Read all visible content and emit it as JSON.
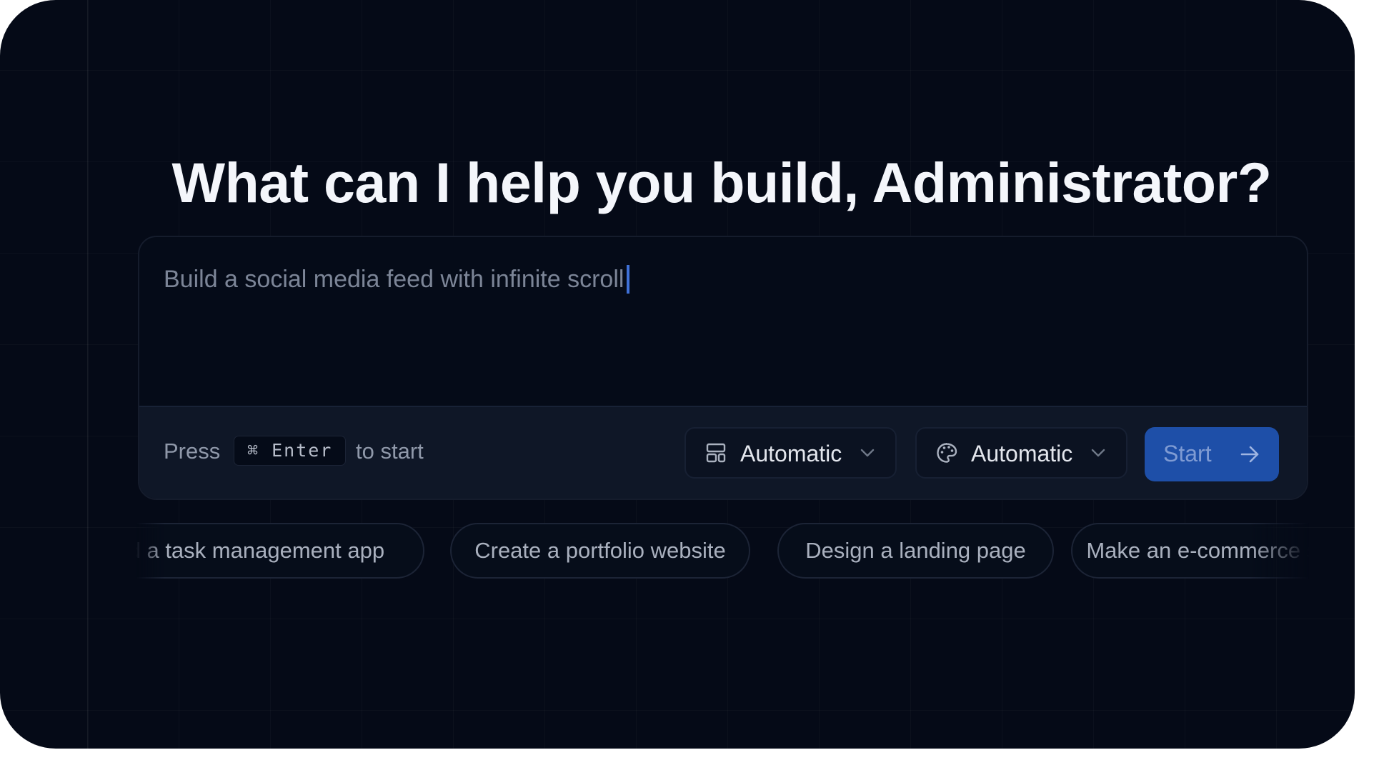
{
  "headline": "What can I help you build, Administrator?",
  "prompt": {
    "text": "Build a social media feed with infinite scroll"
  },
  "footer": {
    "press_label": "Press",
    "shortcut": "⌘ Enter",
    "to_start_label": "to start",
    "layout_select": {
      "icon": "layout-icon",
      "value": "Automatic"
    },
    "style_select": {
      "icon": "palette-icon",
      "value": "Automatic"
    },
    "start_button": {
      "label": "Start",
      "icon": "arrow-right-icon"
    }
  },
  "suggestions": [
    "Build a task management app",
    "Create a portfolio website",
    "Design a landing page",
    "Make an e-commerce store"
  ],
  "colors": {
    "background": "#050a17",
    "accent": "#1e4fa8",
    "caret": "#3f71d8"
  }
}
